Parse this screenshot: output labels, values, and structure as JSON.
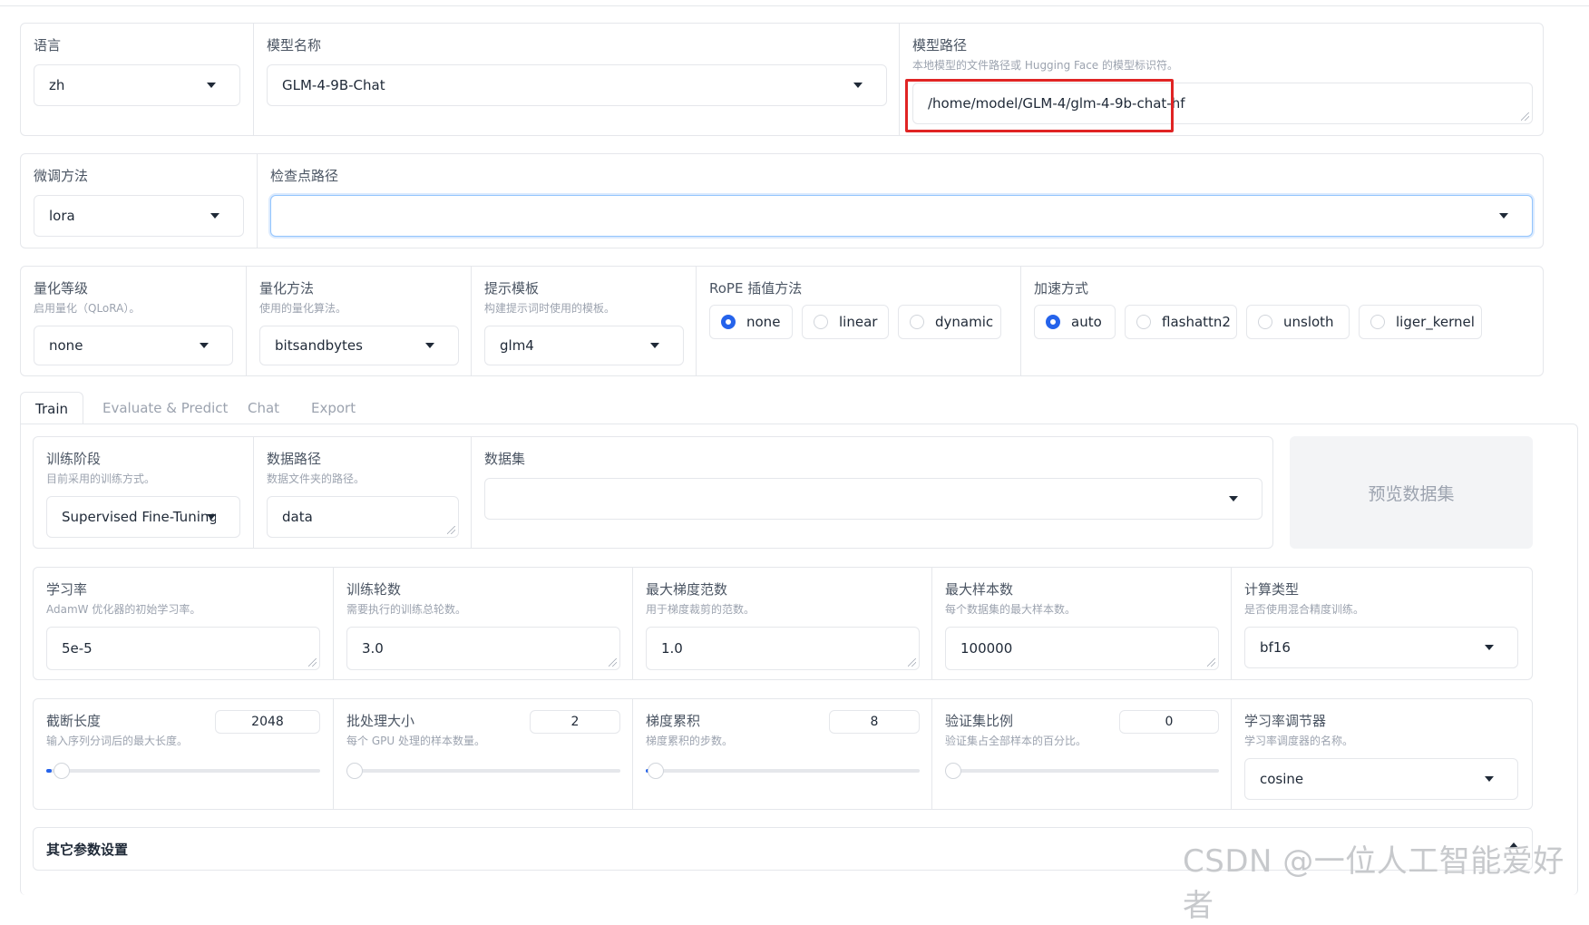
{
  "row1": {
    "language": {
      "label": "语言",
      "value": "zh"
    },
    "model_name": {
      "label": "模型名称",
      "value": "GLM-4-9B-Chat"
    },
    "model_path": {
      "label": "模型路径",
      "hint": "本地模型的文件路径或 Hugging Face 的模型标识符。",
      "value": "/home/model/GLM-4/glm-4-9b-chat-hf"
    }
  },
  "row2": {
    "finetune": {
      "label": "微调方法",
      "value": "lora"
    },
    "checkpoint": {
      "label": "检查点路径",
      "value": ""
    }
  },
  "row3": {
    "quant_level": {
      "label": "量化等级",
      "hint": "启用量化（QLoRA）。",
      "value": "none"
    },
    "quant_method": {
      "label": "量化方法",
      "hint": "使用的量化算法。",
      "value": "bitsandbytes"
    },
    "template": {
      "label": "提示模板",
      "hint": "构建提示词时使用的模板。",
      "value": "glm4"
    },
    "rope": {
      "label": "RoPE 插值方法",
      "options": [
        "none",
        "linear",
        "dynamic"
      ],
      "selected": "none"
    },
    "booster": {
      "label": "加速方式",
      "options": [
        "auto",
        "flashattn2",
        "unsloth",
        "liger_kernel"
      ],
      "selected": "auto"
    }
  },
  "tabs": [
    "Train",
    "Evaluate & Predict",
    "Chat",
    "Export"
  ],
  "train": {
    "stage": {
      "label": "训练阶段",
      "hint": "目前采用的训练方式。",
      "value": "Supervised Fine-Tuning"
    },
    "dataset_dir": {
      "label": "数据路径",
      "hint": "数据文件夹的路径。",
      "value": "data"
    },
    "dataset": {
      "label": "数据集",
      "value": ""
    },
    "preview_button": "预览数据集",
    "learning_rate": {
      "label": "学习率",
      "hint": "AdamW 优化器的初始学习率。",
      "value": "5e-5"
    },
    "epochs": {
      "label": "训练轮数",
      "hint": "需要执行的训练总轮数。",
      "value": "3.0"
    },
    "max_grad_norm": {
      "label": "最大梯度范数",
      "hint": "用于梯度裁剪的范数。",
      "value": "1.0"
    },
    "max_samples": {
      "label": "最大样本数",
      "hint": "每个数据集的最大样本数。",
      "value": "100000"
    },
    "compute_type": {
      "label": "计算类型",
      "hint": "是否使用混合精度训练。",
      "value": "bf16"
    },
    "cutoff_len": {
      "label": "截断长度",
      "hint": "输入序列分词后的最大长度。",
      "value": "2048"
    },
    "batch_size": {
      "label": "批处理大小",
      "hint": "每个 GPU 处理的样本数量。",
      "value": "2"
    },
    "grad_accum": {
      "label": "梯度累积",
      "hint": "梯度累积的步数。",
      "value": "8"
    },
    "val_size": {
      "label": "验证集比例",
      "hint": "验证集占全部样本的百分比。",
      "value": "0"
    },
    "lr_scheduler": {
      "label": "学习率调节器",
      "hint": "学习率调度器的名称。",
      "value": "cosine"
    },
    "extra_settings": "其它参数设置"
  },
  "watermark": "CSDN @一位人工智能爱好者",
  "colors": {
    "accent": "#2563eb",
    "highlight": "#e02424"
  }
}
